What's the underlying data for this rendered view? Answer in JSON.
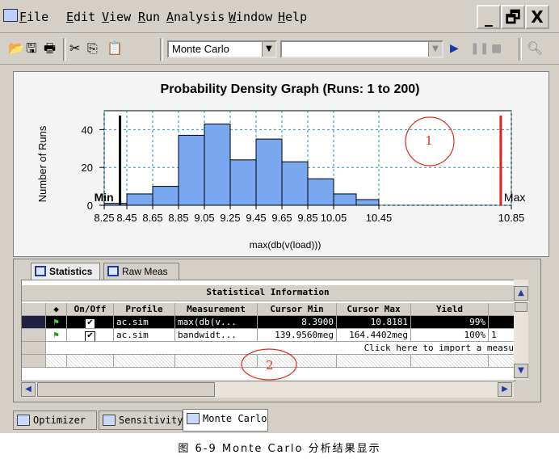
{
  "menu": [
    "File",
    "Edit",
    "View",
    "Run",
    "Analysis",
    "Window",
    "Help"
  ],
  "window_buttons": {
    "minimize": "_",
    "restore": "🗗",
    "close": "X"
  },
  "toolbar": {
    "analysis_combo": "Monte Carlo",
    "second_combo": ""
  },
  "chart_data": {
    "type": "bar",
    "title": "Probability Density Graph (Runs: 1 to 200)",
    "xlabel": "max(db(v(load)))",
    "ylabel": "Number of Runs",
    "x_ticks": [
      "8.25",
      "8.45",
      "8.65",
      "8.85",
      "9.05",
      "9.25",
      "9.45",
      "9.65",
      "9.85",
      "10.05",
      "10.45",
      "10.85"
    ],
    "bins": [
      {
        "from": 8.25,
        "to": 8.45,
        "value": 1
      },
      {
        "from": 8.45,
        "to": 8.65,
        "value": 6
      },
      {
        "from": 8.65,
        "to": 8.85,
        "value": 10
      },
      {
        "from": 8.85,
        "to": 9.05,
        "value": 37
      },
      {
        "from": 9.05,
        "to": 9.25,
        "value": 43
      },
      {
        "from": 9.25,
        "to": 9.45,
        "value": 24
      },
      {
        "from": 9.45,
        "to": 9.65,
        "value": 35
      },
      {
        "from": 9.65,
        "to": 9.85,
        "value": 23
      },
      {
        "from": 9.85,
        "to": 10.05,
        "value": 14
      },
      {
        "from": 10.05,
        "to": 10.25,
        "value": 6
      },
      {
        "from": 10.25,
        "to": 10.45,
        "value": 3
      }
    ],
    "ylim": [
      0,
      50
    ],
    "y_ticks": [
      0,
      20,
      40
    ],
    "cursor_min": {
      "label": "Min",
      "value": 8.39
    },
    "cursor_max": {
      "label": "Max",
      "value": 10.8181
    },
    "annotation": "1",
    "grid": true
  },
  "stats_tabs": [
    {
      "label": "Statistics",
      "active": true
    },
    {
      "label": "Raw Meas",
      "active": false
    }
  ],
  "table": {
    "title": "Statistical Information",
    "headers": [
      "◆",
      "On/Off",
      "Profile",
      "Measurement",
      "Cursor Min",
      "Cursor Max",
      "Yield"
    ],
    "rows": [
      {
        "profile": "ac.sim",
        "measurement": "max(db(v...",
        "cursor_min": "8.3900",
        "cursor_max": "10.8181",
        "yield": "99%",
        "extra": "",
        "selected": true
      },
      {
        "profile": "ac.sim",
        "measurement": "bandwidt...",
        "cursor_min": "139.9560meg",
        "cursor_max": "164.4402meg",
        "yield": "100%",
        "extra": "1",
        "selected": false
      }
    ],
    "import_row": "Click here to import a measu",
    "annotation": "2"
  },
  "bottom_tabs": [
    {
      "label": "Optimizer",
      "active": false
    },
    {
      "label": "Sensitivity",
      "active": false
    },
    {
      "label": "Monte Carlo",
      "active": true
    }
  ],
  "caption": "图 6-9 Monte Carlo 分析结果显示"
}
